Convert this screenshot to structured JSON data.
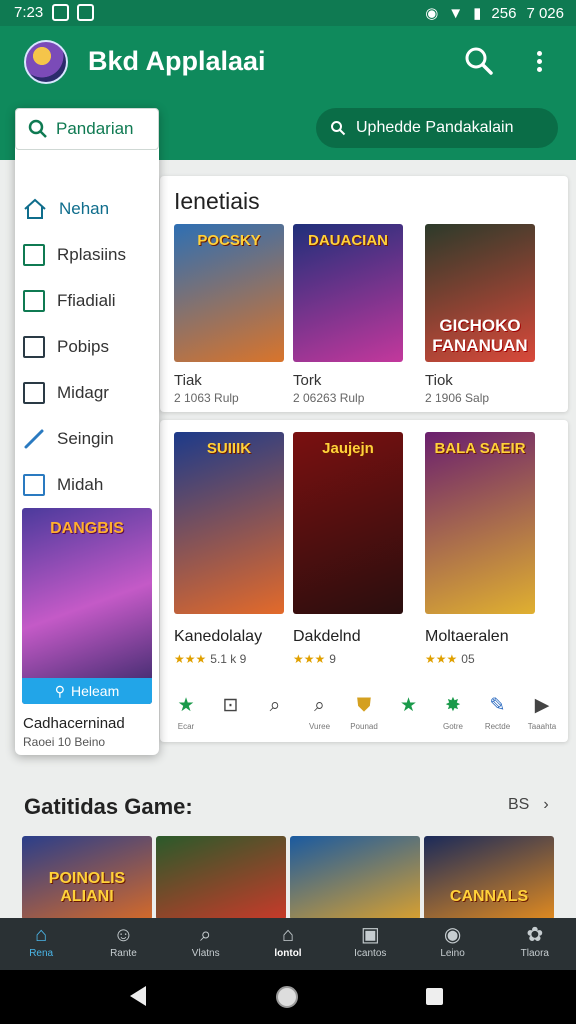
{
  "status": {
    "time": "7:23",
    "battery": "256",
    "clock": "7 026"
  },
  "app": {
    "title": "Bkd Applalaai"
  },
  "drawer": {
    "search_label": "Pandarian",
    "items": [
      {
        "label": "Nehan",
        "icon": "home-icon"
      },
      {
        "label": "Rplasiins",
        "icon": "gallery-icon"
      },
      {
        "label": "Ffiadiali",
        "icon": "edit-icon"
      },
      {
        "label": "Pobips",
        "icon": "checkbox-icon"
      },
      {
        "label": "Midagr",
        "icon": "image-icon"
      },
      {
        "label": "Seingin",
        "icon": "pen-icon"
      },
      {
        "label": "Midah",
        "icon": "square-icon"
      }
    ],
    "promo": {
      "art_title": "DANGBIS",
      "button": "Heleam",
      "name": "Cadhacerninad",
      "sub": "Raoei 10 Beino"
    }
  },
  "top_search": {
    "placeholder": "Uphedde Pandakalain"
  },
  "section1": {
    "title": "Ienetiais",
    "games": [
      {
        "art": "POCSKY",
        "name": "Tiak",
        "sub": "2 1063 Rulp",
        "colors": [
          "#2e6fb3",
          "#d9742b"
        ]
      },
      {
        "art": "DAUACIAN",
        "name": "Tork",
        "sub": "2 06263 Rulp",
        "colors": [
          "#1f2f7a",
          "#c3389c"
        ]
      },
      {
        "art": "GICHOKO FANANUAN",
        "name": "Tiok",
        "sub": "2 1906 Salp",
        "colors": [
          "#2c3a2a",
          "#d9493a"
        ]
      }
    ]
  },
  "section_featured": {
    "games": [
      {
        "art": "SUIIIK",
        "name": "Kanedolalay",
        "rating": "★★★",
        "count": "5.1 k 9",
        "colors": [
          "#1c3a8a",
          "#e36a2a"
        ]
      },
      {
        "art": "Jaujejn",
        "name": "Dakdelnd",
        "rating": "★★★",
        "count": "9",
        "colors": [
          "#7a1010",
          "#2a0e0e"
        ]
      },
      {
        "art": "BALA SAEIR",
        "name": "Moltaeralen",
        "rating": "★★★",
        "count": "05",
        "colors": [
          "#6a1f6e",
          "#e0b030"
        ]
      }
    ],
    "icons": [
      {
        "glyph": "★",
        "label": "Ecar",
        "icon": "star-icon",
        "color": "#1a9a4a"
      },
      {
        "glyph": "⊡",
        "label": "",
        "icon": "box-icon",
        "color": "#444"
      },
      {
        "glyph": "⌕",
        "label": "",
        "icon": "search-icon",
        "color": "#444"
      },
      {
        "glyph": "⌕",
        "label": "Vuree",
        "icon": "search-icon",
        "color": "#444"
      },
      {
        "glyph": "⛊",
        "label": "Pounad",
        "icon": "shield-icon",
        "color": "#d4a020"
      },
      {
        "glyph": "★",
        "label": "",
        "icon": "star-icon",
        "color": "#1a9a4a"
      },
      {
        "glyph": "✸",
        "label": "Gotre",
        "icon": "burst-icon",
        "color": "#1a9a4a"
      },
      {
        "glyph": "✎",
        "label": "Rectde",
        "icon": "brush-icon",
        "color": "#2a6ac0"
      },
      {
        "glyph": "▶",
        "label": "Taaahta",
        "icon": "play-icon",
        "color": "#555"
      }
    ]
  },
  "section2": {
    "title": "Gatitidas Game:",
    "more": "BS",
    "tiles": [
      {
        "art": "POINOLIS ALIANI",
        "colors": [
          "#2a3e8a",
          "#d46a2a"
        ]
      },
      {
        "art": "",
        "colors": [
          "#2a5a2a",
          "#c83a2a"
        ]
      },
      {
        "art": "",
        "colors": [
          "#1a5aa0",
          "#d8a030"
        ]
      },
      {
        "art": "CANNALS",
        "colors": [
          "#1a2a5a",
          "#e08a20"
        ]
      }
    ]
  },
  "bottom_nav": [
    {
      "label": "Rena",
      "glyph": "⌂",
      "icon": "home-icon",
      "state": "active"
    },
    {
      "label": "Rante",
      "glyph": "☺",
      "icon": "face-icon",
      "state": ""
    },
    {
      "label": "Vlatns",
      "glyph": "⌕",
      "icon": "search-icon",
      "state": ""
    },
    {
      "label": "lontol",
      "glyph": "⌂",
      "icon": "house-icon",
      "state": "sel"
    },
    {
      "label": "Icantos",
      "glyph": "▣",
      "icon": "bookmark-icon",
      "state": ""
    },
    {
      "label": "Leino",
      "glyph": "◉",
      "icon": "chat-icon",
      "state": ""
    },
    {
      "label": "Tlaora",
      "glyph": "✿",
      "icon": "gear-icon",
      "state": ""
    }
  ]
}
